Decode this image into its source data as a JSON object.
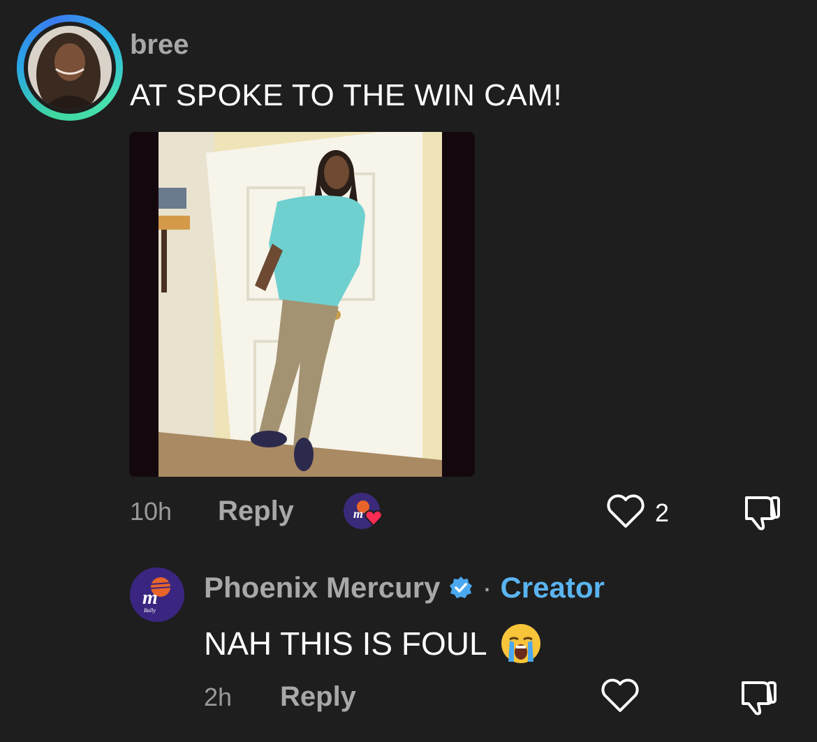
{
  "comment": {
    "username": "bree",
    "text": "AT SPOKE TO THE WIN CAM!",
    "time": "10h",
    "reply_label": "Reply",
    "like_count": "2"
  },
  "reply": {
    "username": "Phoenix Mercury",
    "separator": "·",
    "role": "Creator",
    "text": "NAH THIS IS FOUL",
    "emoji": "😭",
    "time": "2h",
    "reply_label": "Reply"
  },
  "icons": {
    "like": "heart-outline-icon",
    "dislike": "thumbs-down-icon",
    "verified": "verified-badge-icon"
  },
  "colors": {
    "background": "#1e1e1e",
    "creator": "#5ab4f0",
    "heart_badge": "#ff2d55",
    "team_purple": "#3a2680"
  }
}
